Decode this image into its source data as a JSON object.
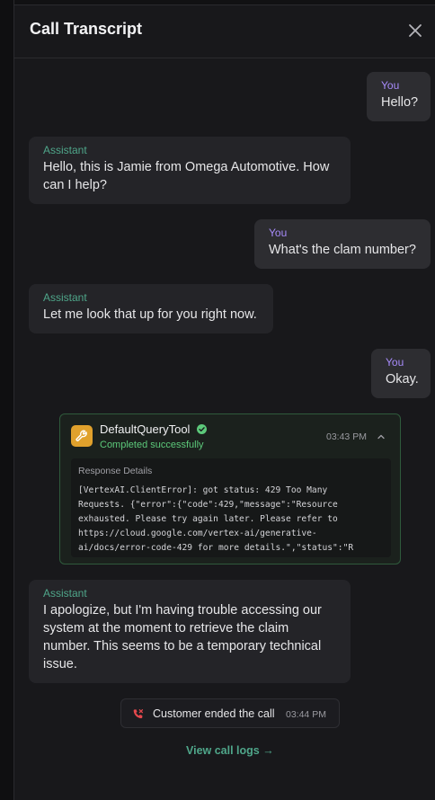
{
  "header": {
    "title": "Call Transcript"
  },
  "messages": [
    {
      "role": "You",
      "text": "Hello?"
    },
    {
      "role": "Assistant",
      "text": "Hello, this is Jamie from Omega Automotive. How can I help?"
    },
    {
      "role": "You",
      "text": "What's the clam number?"
    },
    {
      "role": "Assistant",
      "text": "Let me look that up for you right now."
    },
    {
      "role": "You",
      "text": "Okay."
    },
    {
      "role": "Assistant",
      "text": "I apologize, but I'm having trouble accessing our system at the moment to retrieve the claim number. This seems to be a temporary technical issue."
    }
  ],
  "tool": {
    "name": "DefaultQueryTool",
    "status": "Completed successfully",
    "time": "03:43 PM",
    "response_label": "Response Details",
    "response_text": "[VertexAI.ClientError]: got status: 429 Too Many\nRequests. {\"error\":{\"code\":429,\"message\":\"Resource\nexhausted. Please try again later. Please refer to\nhttps://cloud.google.com/vertex-ai/generative-\nai/docs/error-code-429 for more details.\",\"status\":\"R"
  },
  "call_ended": {
    "text": "Customer ended the call",
    "time": "03:44 PM"
  },
  "logs_link": "View call logs →",
  "colors": {
    "user_role": "#a78bfa",
    "assistant_role": "#4fa68a",
    "tool_icon": "#e0a12c",
    "success": "#5cc97a",
    "end_call": "#e5484d"
  },
  "icons": {
    "close": "close-icon",
    "tool": "wrench-icon",
    "check": "check-circle-icon",
    "collapse": "chevron-up-icon",
    "phone": "phone-end-icon"
  }
}
